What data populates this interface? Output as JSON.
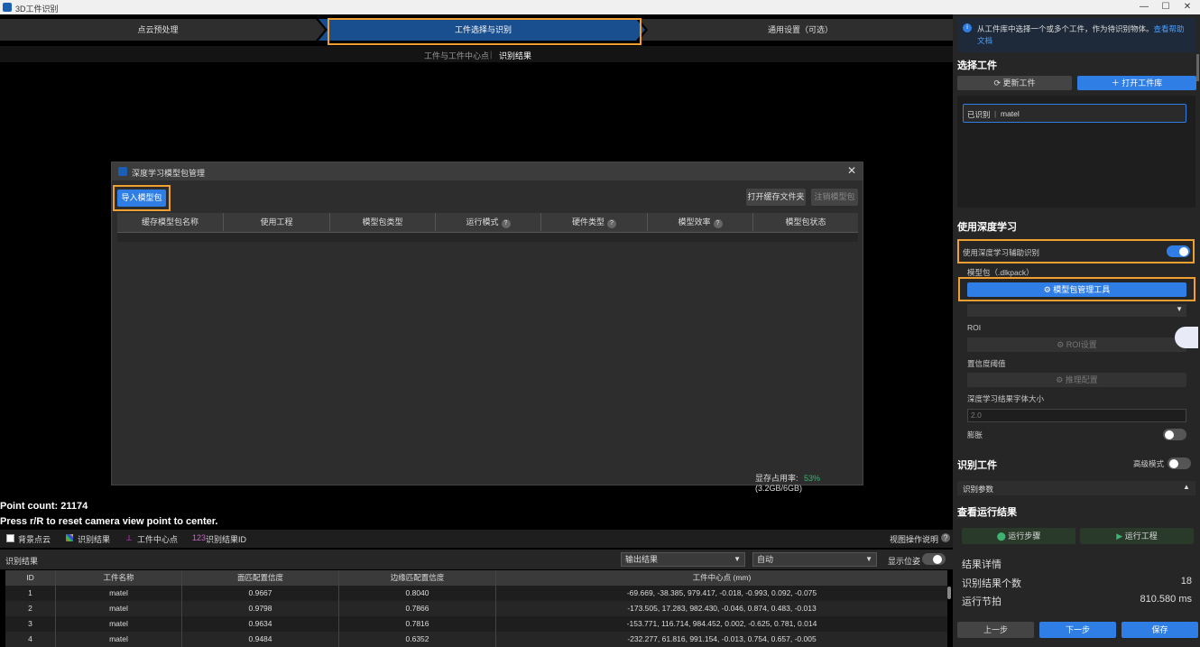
{
  "app": {
    "title": "3D工件识别"
  },
  "steps": [
    "点云预处理",
    "工件选择与识别",
    "通用设置（可选）"
  ],
  "subnav": {
    "item1": "工件与工件中心点",
    "item2": "识别结果"
  },
  "viewport": {
    "point_count": "Point count: 21174",
    "reset_hint": "Press r/R to reset camera view point to center."
  },
  "dialog": {
    "title": "深度学习模型包管理",
    "import_button": "导入模型包",
    "open_cache_button": "打开缓存文件夹",
    "unregister_button": "注销模型包",
    "columns": [
      "缓存模型包名称",
      "使用工程",
      "模型包类型",
      "运行模式",
      "硬件类型",
      "模型效率",
      "模型包状态"
    ],
    "vram_label": "显存占用率:",
    "vram_percent": "53%",
    "vram_detail": "(3.2GB/6GB)"
  },
  "legend": {
    "bg_cloud": "背景点云",
    "recog_result": "识别结果",
    "center": "工件中心点",
    "id_prefix": "123",
    "result_id": "识别结果ID",
    "view_help": "视图操作说明"
  },
  "results": {
    "label": "识别结果",
    "output_select": "输出结果",
    "auto_select": "自动",
    "show_pose": "显示位姿",
    "columns": [
      "ID",
      "工件名称",
      "面匹配置信度",
      "边缘匹配置信度",
      "工件中心点 (mm)"
    ],
    "rows": [
      [
        "1",
        "matel",
        "0.9667",
        "0.8040",
        "-69.669, -38.385, 979.417, -0.018, -0.993, 0.092, -0.075"
      ],
      [
        "2",
        "matel",
        "0.9798",
        "0.7866",
        "-173.505, 17.283, 982.430, -0.046, 0.874, 0.483, -0.013"
      ],
      [
        "3",
        "matel",
        "0.9634",
        "0.7816",
        "-153.771, 116.714, 984.452, 0.002, -0.625, 0.781, 0.014"
      ],
      [
        "4",
        "matel",
        "0.9484",
        "0.6352",
        "-232.277, 61.816, 991.154, -0.013, 0.754, 0.657, -0.005"
      ]
    ]
  },
  "panel": {
    "info_text": "从工件库中选择一个或多个工件，作为待识别物体。",
    "help_link": "查看帮助文档",
    "select_title": "选择工件",
    "update_btn": "更新工件",
    "open_lib_btn": "打开工件库",
    "recognized_label": "已识别",
    "recognized_value": "matel",
    "dl_title": "使用深度学习",
    "dl_assist": "使用深度学习辅助识别",
    "model_pkg_label": "模型包（.dlkpack）",
    "model_tool_btn": "模型包管理工具",
    "roi_label": "ROI",
    "roi_btn": "ROI设置",
    "conf_label": "置信度阈值",
    "infer_btn": "推理配置",
    "font_label": "深度学习结果字体大小",
    "font_value": "2.0",
    "dilate_label": "膨胀",
    "recog_title": "识别工件",
    "advanced_label": "高级模式",
    "params_label": "识别参数",
    "run_title": "查看运行结果",
    "run_step_btn": "运行步骤",
    "run_project_btn": "运行工程",
    "detail_title": "结果详情",
    "count_label": "识别结果个数",
    "count_value": "18",
    "takt_label": "运行节拍",
    "takt_value": "810.580 ms",
    "prev_btn": "上一步",
    "next_btn": "下一步",
    "save_btn": "保存"
  },
  "colors": {
    "accent": "#2f7ee6",
    "highlight": "#f0a030",
    "active_step": "#1a4f8f",
    "green": "#3cb371"
  }
}
